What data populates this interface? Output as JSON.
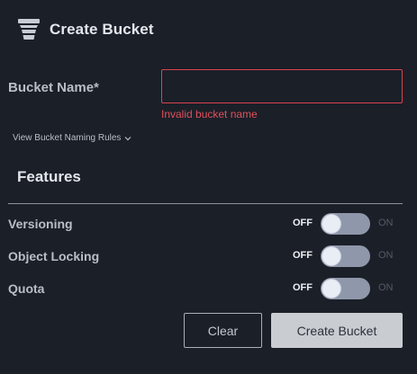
{
  "header": {
    "title": "Create Bucket",
    "icon": "bucket-icon"
  },
  "bucket_name": {
    "label": "Bucket Name*",
    "value": "",
    "placeholder": "",
    "error": "Invalid bucket name"
  },
  "rules_link": {
    "label": "View Bucket Naming Rules",
    "icon": "chevron-down-icon"
  },
  "features": {
    "title": "Features",
    "items": [
      {
        "label": "Versioning",
        "off_label": "OFF",
        "on_label": "ON",
        "enabled": false
      },
      {
        "label": "Object Locking",
        "off_label": "OFF",
        "on_label": "ON",
        "enabled": false
      },
      {
        "label": "Quota",
        "off_label": "OFF",
        "on_label": "ON",
        "enabled": false
      }
    ]
  },
  "actions": {
    "clear_label": "Clear",
    "create_label": "Create Bucket"
  },
  "colors": {
    "background": "#1b1f28",
    "error": "#e0505b",
    "toggle_track": "#8f97aa",
    "primary_button": "#c9ccd1"
  }
}
